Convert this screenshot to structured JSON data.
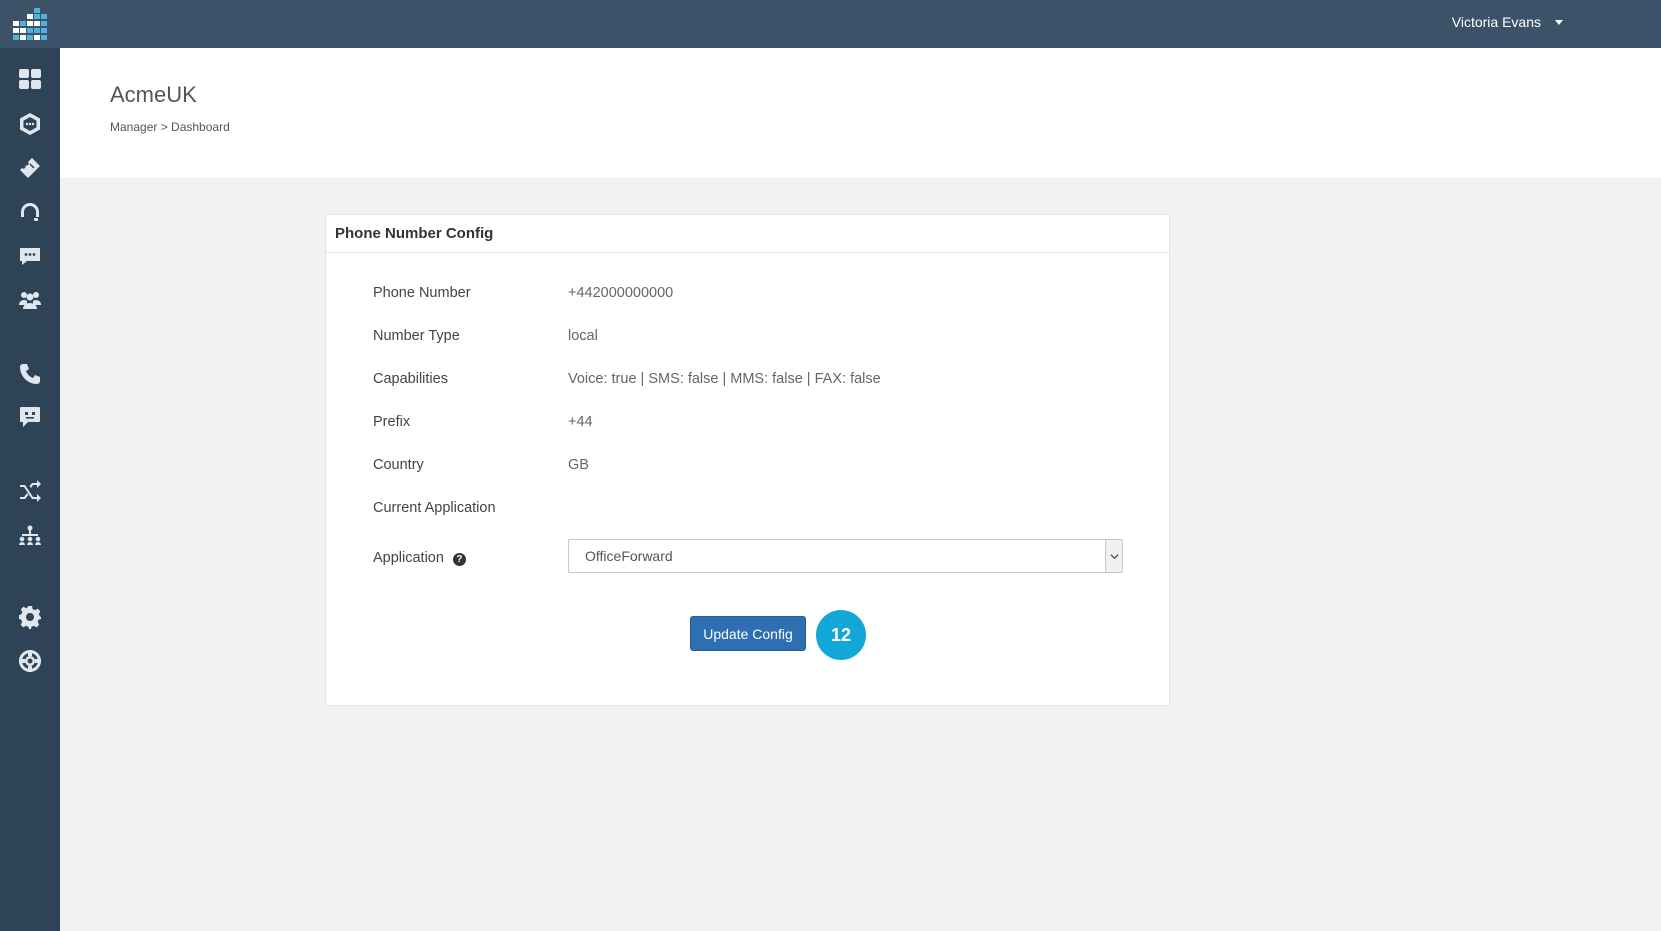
{
  "app": {
    "user_name": "Victoria Evans"
  },
  "header": {
    "title": "AcmeUK",
    "breadcrumb": "Manager > Dashboard"
  },
  "sidebar": {
    "icons": [
      "dashboard-icon",
      "hexagon-chat-icon",
      "ticket-icon",
      "headset-icon",
      "chat-bubble-icon",
      "users-group-icon",
      "phone-icon",
      "message-icon",
      "shuffle-icon",
      "org-chart-icon",
      "gear-icon",
      "lifebuoy-icon"
    ]
  },
  "panel": {
    "title": "Phone Number Config",
    "fields": [
      {
        "label": "Phone Number",
        "value": "+442000000000"
      },
      {
        "label": "Number Type",
        "value": "local"
      },
      {
        "label": "Capabilities",
        "value": "Voice: true | SMS: false | MMS: false | FAX: false"
      },
      {
        "label": "Prefix",
        "value": "+44"
      },
      {
        "label": "Country",
        "value": "GB"
      },
      {
        "label": "Current Application",
        "value": ""
      }
    ],
    "application_label": "Application",
    "application_selected": "OfficeForward",
    "button_label": "Update Config",
    "step_badge": "12"
  },
  "colors": {
    "topbar": "#3c5268",
    "sidebar": "#2f4356",
    "button": "#2d6fb2",
    "badge": "#13a7d8"
  }
}
